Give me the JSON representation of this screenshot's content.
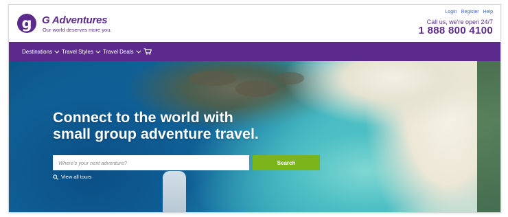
{
  "header": {
    "logo_mark": "g",
    "brand_name": "G Adventures",
    "tagline": "Our world deserves more you.",
    "util_links": [
      "Login",
      "Register",
      "Help"
    ],
    "call_text": "Call us, we're open 24/7",
    "phone": "1 888 800 4100"
  },
  "nav": {
    "items": [
      "Destinations",
      "Travel Styles",
      "Travel Deals"
    ],
    "cart_icon": "cart-icon"
  },
  "hero": {
    "headline_line1": "Connect to the world with",
    "headline_line2": "small group adventure travel.",
    "search_placeholder": "Where's your next adventure?",
    "search_button": "Search",
    "view_all": "View all tours"
  },
  "colors": {
    "brand_purple": "#5b2a8c",
    "search_green": "#7bb51a",
    "link_blue": "#3a64c8"
  }
}
